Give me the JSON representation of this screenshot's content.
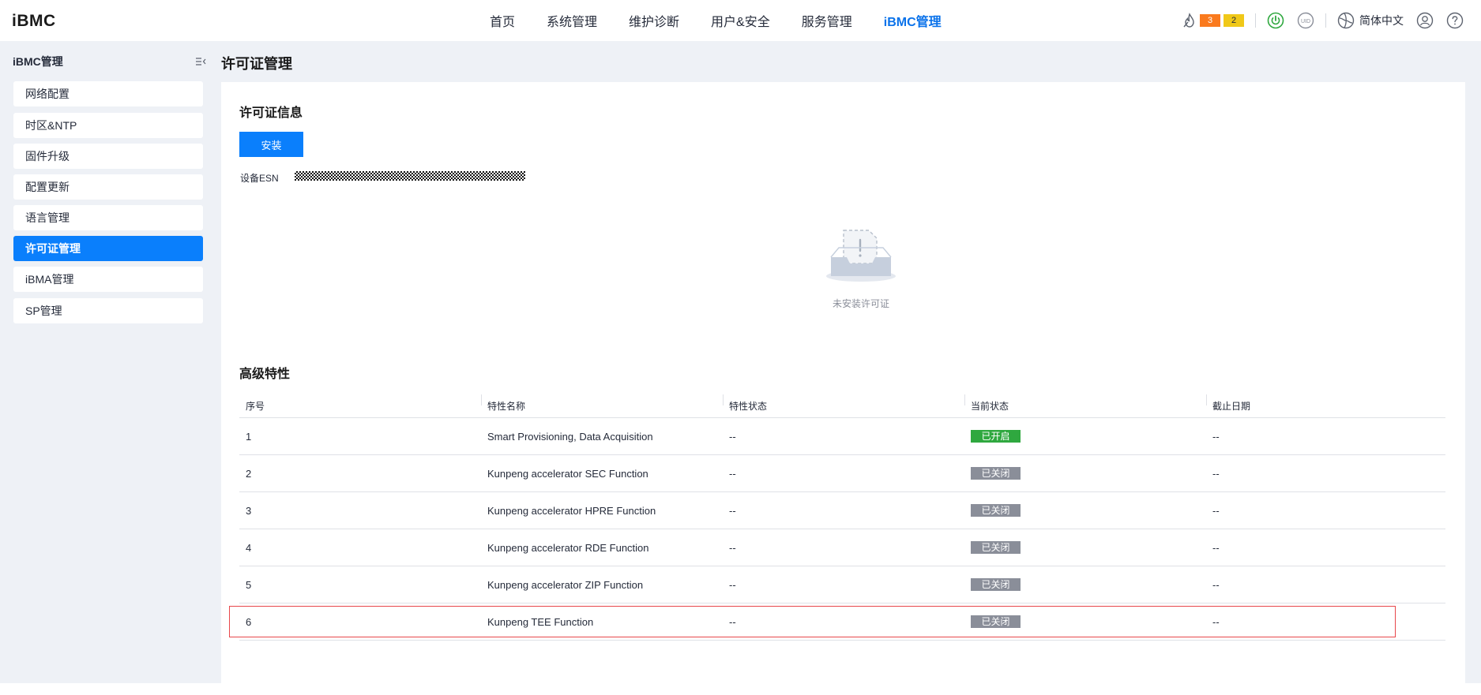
{
  "app": {
    "logo": "iBMC"
  },
  "nav": {
    "items": [
      {
        "label": "首页",
        "active": false
      },
      {
        "label": "系统管理",
        "active": false
      },
      {
        "label": "维护诊断",
        "active": false
      },
      {
        "label": "用户&安全",
        "active": false
      },
      {
        "label": "服务管理",
        "active": false
      },
      {
        "label": "iBMC管理",
        "active": true
      }
    ]
  },
  "header_right": {
    "alarm_counts": {
      "major": "3",
      "minor": "2"
    },
    "alarm_colors": {
      "major": "#fa7a1e",
      "minor": "#f0c818"
    },
    "language": "简体中文",
    "icons": [
      "alarm-icon",
      "power-icon",
      "uid-icon",
      "language-icon",
      "user-icon",
      "help-icon"
    ]
  },
  "sidebar": {
    "title": "iBMC管理",
    "items": [
      {
        "label": "网络配置",
        "active": false
      },
      {
        "label": "时区&NTP",
        "active": false
      },
      {
        "label": "固件升级",
        "active": false
      },
      {
        "label": "配置更新",
        "active": false
      },
      {
        "label": "语言管理",
        "active": false
      },
      {
        "label": "许可证管理",
        "active": true
      },
      {
        "label": "iBMA管理",
        "active": false
      },
      {
        "label": "SP管理",
        "active": false
      }
    ]
  },
  "page": {
    "title": "许可证管理",
    "license_info": {
      "title": "许可证信息",
      "install_button": "安装",
      "esn_label": "设备ESN",
      "empty_text": "未安装许可证"
    },
    "advanced": {
      "title": "高级特性",
      "columns": [
        "序号",
        "特性名称",
        "特性状态",
        "当前状态",
        "截止日期"
      ],
      "rows": [
        {
          "no": "1",
          "name": "Smart Provisioning, Data Acquisition",
          "feature_state": "--",
          "current_state": "已开启",
          "status_kind": "on",
          "deadline": "--"
        },
        {
          "no": "2",
          "name": "Kunpeng accelerator SEC Function",
          "feature_state": "--",
          "current_state": "已关闭",
          "status_kind": "off",
          "deadline": "--"
        },
        {
          "no": "3",
          "name": "Kunpeng accelerator HPRE Function",
          "feature_state": "--",
          "current_state": "已关闭",
          "status_kind": "off",
          "deadline": "--"
        },
        {
          "no": "4",
          "name": "Kunpeng accelerator RDE Function",
          "feature_state": "--",
          "current_state": "已关闭",
          "status_kind": "off",
          "deadline": "--"
        },
        {
          "no": "5",
          "name": "Kunpeng accelerator ZIP Function",
          "feature_state": "--",
          "current_state": "已关闭",
          "status_kind": "off",
          "deadline": "--"
        },
        {
          "no": "6",
          "name": "Kunpeng TEE Function",
          "feature_state": "--",
          "current_state": "已关闭",
          "status_kind": "off",
          "deadline": "--"
        }
      ]
    }
  },
  "colors": {
    "accent": "#0a7ffc",
    "status_on": "#2fa83f",
    "status_off": "#8a8e99",
    "highlight": "#e8474b"
  }
}
